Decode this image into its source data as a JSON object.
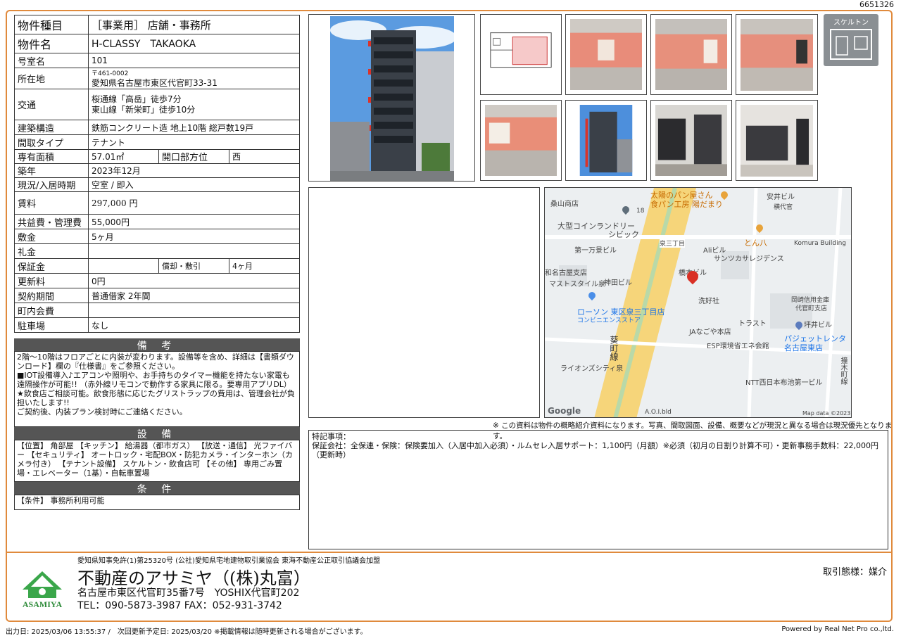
{
  "doc_id": "6651326",
  "info": {
    "type_label": "物件種目",
    "type_value": "［事業用］ 店舗・事務所",
    "name_label": "物件名",
    "name_value": "H-CLASSY　TAKAOKA",
    "room_label": "号室名",
    "room_value": "101",
    "address_label": "所在地",
    "postal": "〒461-0002",
    "address_value": "愛知県名古屋市東区代官町33-31",
    "transport_label": "交通",
    "transport_1": "桜通線「高岳」徒歩7分",
    "transport_2": "東山線「新栄町」徒歩10分",
    "structure_label": "建築構造",
    "structure_value": "鉄筋コンクリート造 地上10階 総戸数19戸",
    "layout_label": "間取タイプ",
    "layout_value": "テナント",
    "area_label": "専有面積",
    "area_value": "57.01㎡",
    "opening_label": "開口部方位",
    "opening_value": "西",
    "built_label": "築年",
    "built_value": "2023年12月",
    "status_label": "現況/入居時期",
    "status_value": "空室 / 即入",
    "rent_label": "賃料",
    "rent_value": "297,000 円",
    "fee_label": "共益費・管理費",
    "fee_value": "55,000円",
    "deposit_label": "敷金",
    "deposit_value": "5ヶ月",
    "key_money_label": "礼金",
    "key_money_value": "",
    "guarantee_label": "保証金",
    "guarantee_value": "",
    "amort_label": "償却・敷引",
    "amort_value": "4ヶ月",
    "renewal_label": "更新料",
    "renewal_value": "0円",
    "contract_label": "契約期間",
    "contract_value": "普通借家 2年間",
    "town_fee_label": "町内会費",
    "town_fee_value": "",
    "parking_label": "駐車場",
    "parking_value": "なし"
  },
  "remarks_head": "備 考",
  "remarks_text": "2階～10階はフロアごとに内装が変わります。設備等を含め、詳細は【書類ダウンロード】欄の『仕様書』をご参照ください。\n■IOT設備導入♪エアコンや照明や、お手持ちのタイマー機能を持たない家電も遠隔操作が可能!! （赤外線リモコンで動作する家具に限る。要専用アプリDL）\n★飲食店ご相談可能。飲食形態に応じたグリストラップの費用は、管理会社が負担いたします!!\nご契約後、内装プラン検討時にご連絡ください。",
  "equipment_head": "設 備",
  "equipment_text": "【位置】 角部屋 【キッチン】 給湯器（都市ガス） 【放送・通信】 光ファイバー 【セキュリティ】 オートロック・宅配BOX・防犯カメラ・インターホン（カメラ付き） 【テナント設備】 スケルトン・飲食店可 【その他】 専用ごみ置場・エレベーター（1基）・自転車置場",
  "conditions_head": "条 件",
  "conditions_text": "【条件】 事務所利用可能",
  "skeleton_badge": "スケルトン",
  "map": {
    "labels": [
      "桑山商店",
      "太陽のパン屋さん",
      "食パン工房 陽だまり",
      "安井ビル",
      "横代官",
      "大型コインランドリー",
      "シビック",
      "泉三丁目",
      "Aliビル",
      "とん八",
      "Komura Building",
      "第一万景ビル",
      "サンツカサレジデンス",
      "和名古屋支店",
      "マストスタイル泉",
      "神田ビル",
      "橋本ビル",
      "洗好社",
      "ローソン 東区泉三丁目店",
      "コンビニエンスストア",
      "岡崎信用金庫",
      "代官町支店",
      "坪井ビル",
      "JAなごや本店",
      "トラスト",
      "パジェットレンタ",
      "名古屋東店",
      "ESP環境省エネ会館",
      "ライオンズシティ泉",
      "NTT西日本布池第一ビル",
      "A.O.I.bld",
      "葵町線",
      "撞木町線",
      "Google",
      "Map data ©2023",
      "18"
    ]
  },
  "note_line": "※ この資料は物件の概略紹介資料になります。写真、間取図面、設備、概要などが現況と異なる場合は現況優先となります。",
  "special_head": "特記事項：",
  "special_text": "保証会社：全保連・保険：保険要加入（入居中加入必須）・ルムセレ入居サポート：1,100円（月額）※必須（初月の日割り計算不可）・更新事務手数料：22,000円（更新時）",
  "footer": {
    "license": "愛知県知事免許(1)第25320号 (公社)愛知県宅地建物取引業協会 東海不動産公正取引協議会加盟",
    "company": "不動産のアサミヤ（(株)丸富）",
    "address": "名古屋市東区代官町35番7号　YOSHIX代官町202",
    "tel": "TEL：090-5873-3987 FAX：052-931-3742",
    "trade": "取引態様：媒介",
    "logo_text": "ASAMIYA",
    "output_date": "出力日: 2025/03/06 13:55:37 /　次回更新予定日: 2025/03/20 ※掲載情報は随時更新される場合がございます。",
    "powered": "Powered by Real Net Pro co.,ltd."
  },
  "colors": {
    "frame": "#e08a3c",
    "subhead": "#555555",
    "badge": "#8a8f93",
    "pin": "#d93025"
  }
}
